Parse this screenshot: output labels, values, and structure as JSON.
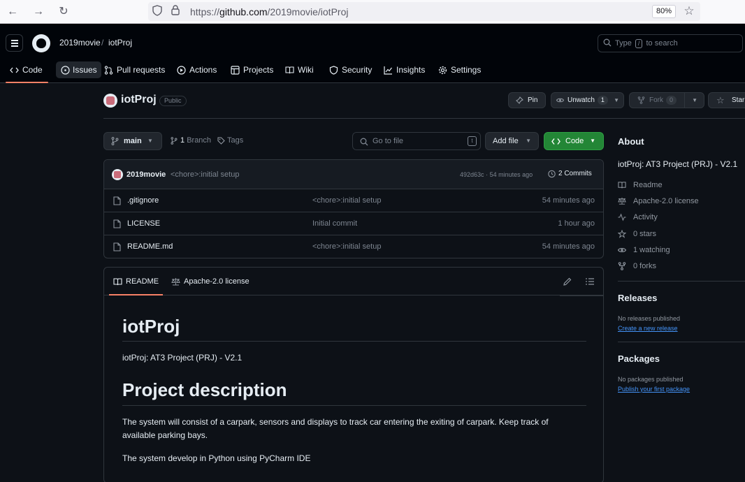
{
  "browser": {
    "url_scheme": "https://",
    "url_host": "github.com",
    "url_path": "/2019movie/iotProj",
    "zoom": "80%"
  },
  "header": {
    "owner": "2019movie",
    "separator": "/",
    "repo": "iotProj",
    "search_prefix": "Type",
    "search_key": "/",
    "search_suffix": "to search"
  },
  "nav_tabs": [
    {
      "label": "Code",
      "icon": "code-icon"
    },
    {
      "label": "Issues",
      "icon": "issue-icon"
    },
    {
      "label": "Pull requests",
      "icon": "pull-request-icon"
    },
    {
      "label": "Actions",
      "icon": "play-icon"
    },
    {
      "label": "Projects",
      "icon": "table-icon"
    },
    {
      "label": "Wiki",
      "icon": "book-icon"
    },
    {
      "label": "Security",
      "icon": "shield-icon"
    },
    {
      "label": "Insights",
      "icon": "graph-icon"
    },
    {
      "label": "Settings",
      "icon": "gear-icon"
    }
  ],
  "repo": {
    "name": "iotProj",
    "visibility": "Public",
    "pin": "Pin",
    "unwatch": "Unwatch",
    "watch_count": "1",
    "fork": "Fork",
    "fork_count": "0",
    "star": "Star"
  },
  "toolbar": {
    "branch": "main",
    "branch_count": "1",
    "branch_label": "Branch",
    "tags_label": "Tags",
    "goto_placeholder": "Go to file",
    "goto_key": "t",
    "add_file": "Add file",
    "code": "Code"
  },
  "latest_commit": {
    "author": "2019movie",
    "message": "<chore>:initial setup",
    "hash": "492d63c",
    "separator": "·",
    "time": "54 minutes ago",
    "commits": "2 Commits"
  },
  "files": [
    {
      "name": ".gitignore",
      "message": "<chore>:initial setup",
      "time": "54 minutes ago"
    },
    {
      "name": "LICENSE",
      "message": "Initial commit",
      "time": "1 hour ago"
    },
    {
      "name": "README.md",
      "message": "<chore>:initial setup",
      "time": "54 minutes ago"
    }
  ],
  "readme": {
    "tab_readme": "README",
    "tab_license": "Apache-2.0 license",
    "h1": "iotProj",
    "intro": "iotProj: AT3 Project (PRJ) - V2.1",
    "h2": "Project description",
    "p1": "The system will consist of a carpark, sensors and displays to track car entering the exiting of carpark. Keep track of available parking bays.",
    "p2": "The system develop in Python using PyCharm IDE"
  },
  "sidebar": {
    "about_title": "About",
    "description": "iotProj: AT3 Project (PRJ) - V2.1",
    "items": [
      {
        "label": "Readme",
        "icon": "book-icon"
      },
      {
        "label": "Apache-2.0 license",
        "icon": "law-icon"
      },
      {
        "label": "Activity",
        "icon": "pulse-icon"
      },
      {
        "label": "0 stars",
        "icon": "star-icon"
      },
      {
        "label": "1 watching",
        "icon": "eye-icon"
      },
      {
        "label": "0 forks",
        "icon": "fork-icon"
      }
    ],
    "releases_title": "Releases",
    "releases_none": "No releases published",
    "releases_link": "Create a new release",
    "packages_title": "Packages",
    "packages_none": "No packages published",
    "packages_link": "Publish your first package"
  }
}
